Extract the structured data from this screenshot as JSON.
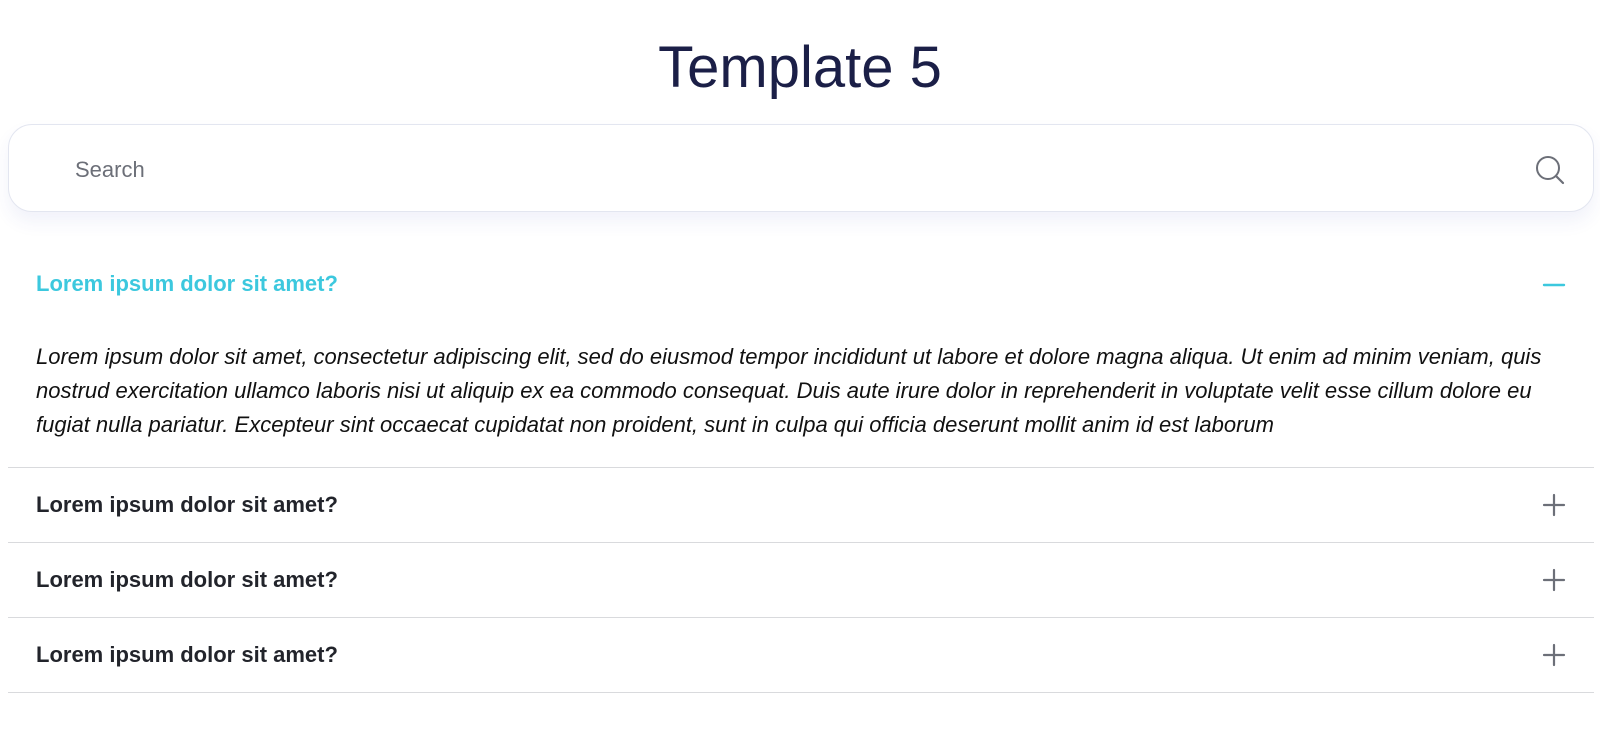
{
  "page": {
    "title": "Template 5"
  },
  "search": {
    "placeholder": "Search",
    "value": "",
    "icon": "search-icon"
  },
  "faq": {
    "items": [
      {
        "question": "Lorem ipsum dolor sit amet?",
        "answer": "Lorem ipsum dolor sit amet, consectetur adipiscing elit, sed do eiusmod tempor incididunt ut labore et dolore magna aliqua. Ut enim ad minim veniam, quis nostrud exercitation ullamco laboris nisi ut aliquip ex ea commodo consequat. Duis aute irure dolor in reprehenderit in voluptate velit esse cillum dolore eu fugiat nulla pariatur. Excepteur sint occaecat cupidatat non proident, sunt in culpa qui officia deserunt mollit anim id est laborum",
        "expanded": true,
        "icon": "minus-icon"
      },
      {
        "question": "Lorem ipsum dolor sit amet?",
        "expanded": false,
        "icon": "plus-icon"
      },
      {
        "question": "Lorem ipsum dolor sit amet?",
        "expanded": false,
        "icon": "plus-icon"
      },
      {
        "question": "Lorem ipsum dolor sit amet?",
        "expanded": false,
        "icon": "plus-icon"
      }
    ]
  },
  "colors": {
    "title": "#1b1f47",
    "accent": "#3cc8de",
    "question": "#22242b",
    "icon": "#6c6f78",
    "divider": "#d9dadd"
  }
}
